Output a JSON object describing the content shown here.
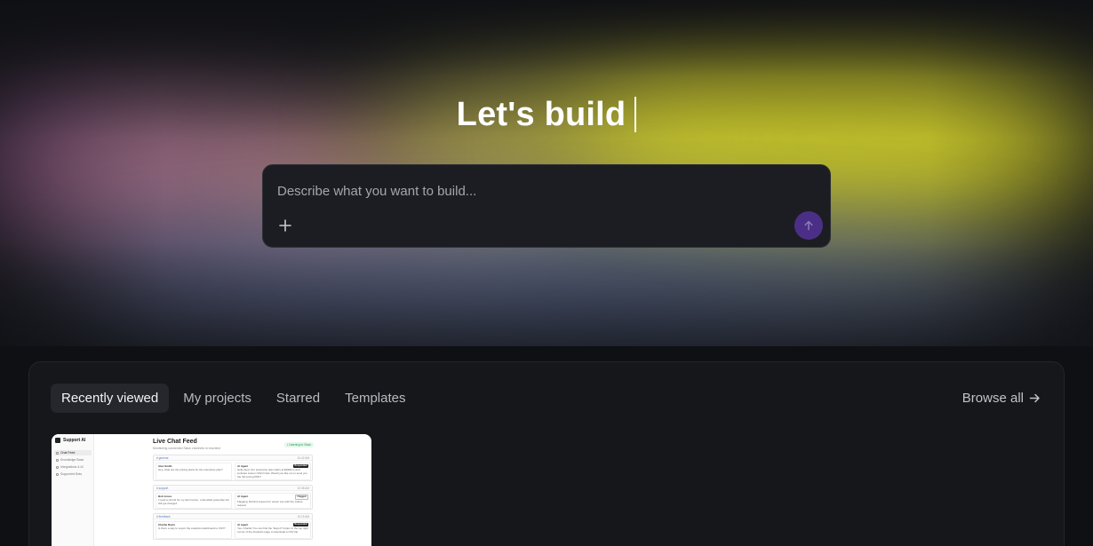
{
  "hero": {
    "headline": "Let's build",
    "prompt": {
      "placeholder": "Describe what you want to build...",
      "plus_icon": "plus-icon",
      "send_icon": "arrow-up-icon",
      "send_color": "#4b2f86"
    }
  },
  "projects": {
    "tabs": [
      {
        "label": "Recently viewed",
        "active": true
      },
      {
        "label": "My projects",
        "active": false
      },
      {
        "label": "Starred",
        "active": false
      },
      {
        "label": "Templates",
        "active": false
      }
    ],
    "browse_all": "Browse all",
    "browse_icon": "arrow-right-icon",
    "cards": [
      {
        "preview": {
          "brand": "Support AI",
          "nav": [
            "Chat Feed",
            "Knowledge Base",
            "Integrations & AI",
            "Supported Bots"
          ],
          "title": "Live Chat Feed",
          "subtitle": "Monitoring connected Slack channels in real-time",
          "status_badge": "• Listening to Slack",
          "conversations": [
            {
              "channel": "# general",
              "time": "10:42 AM",
              "user": "Alex Smith",
              "user_text": "Hey, what are the pricing plans for the enterprise plan?",
              "agent": "AI Agent",
              "agent_tag": "Responded",
              "agent_text": "Hello Alex! Our enterprise plan starts at $499/mo and includes custom SSO limits. Would you like me to send you the full pricing PDF?"
            },
            {
              "channel": "# support",
              "time": "10:38 AM",
              "user": "Bob Jones",
              "user_text": "I need a refund for my last invoice, I cancelled yesterday but still got charged.",
              "agent": "AI Agent",
              "agent_tag": "Flagged",
              "agent_text": "Flagging: Refund request for owner exe with the culture request"
            },
            {
              "channel": "# feedback",
              "time": "10:15 AM",
              "user": "Charlie Davis",
              "user_text": "Is there a way to export the analytics dashboard to CSV?",
              "agent": "AI Agent",
              "agent_tag": "Responded",
              "agent_text": "Yes, Charlie! You can find the \"Export\" button in the top right corner of the Analytics page to download a CSV file."
            }
          ]
        }
      }
    ]
  }
}
